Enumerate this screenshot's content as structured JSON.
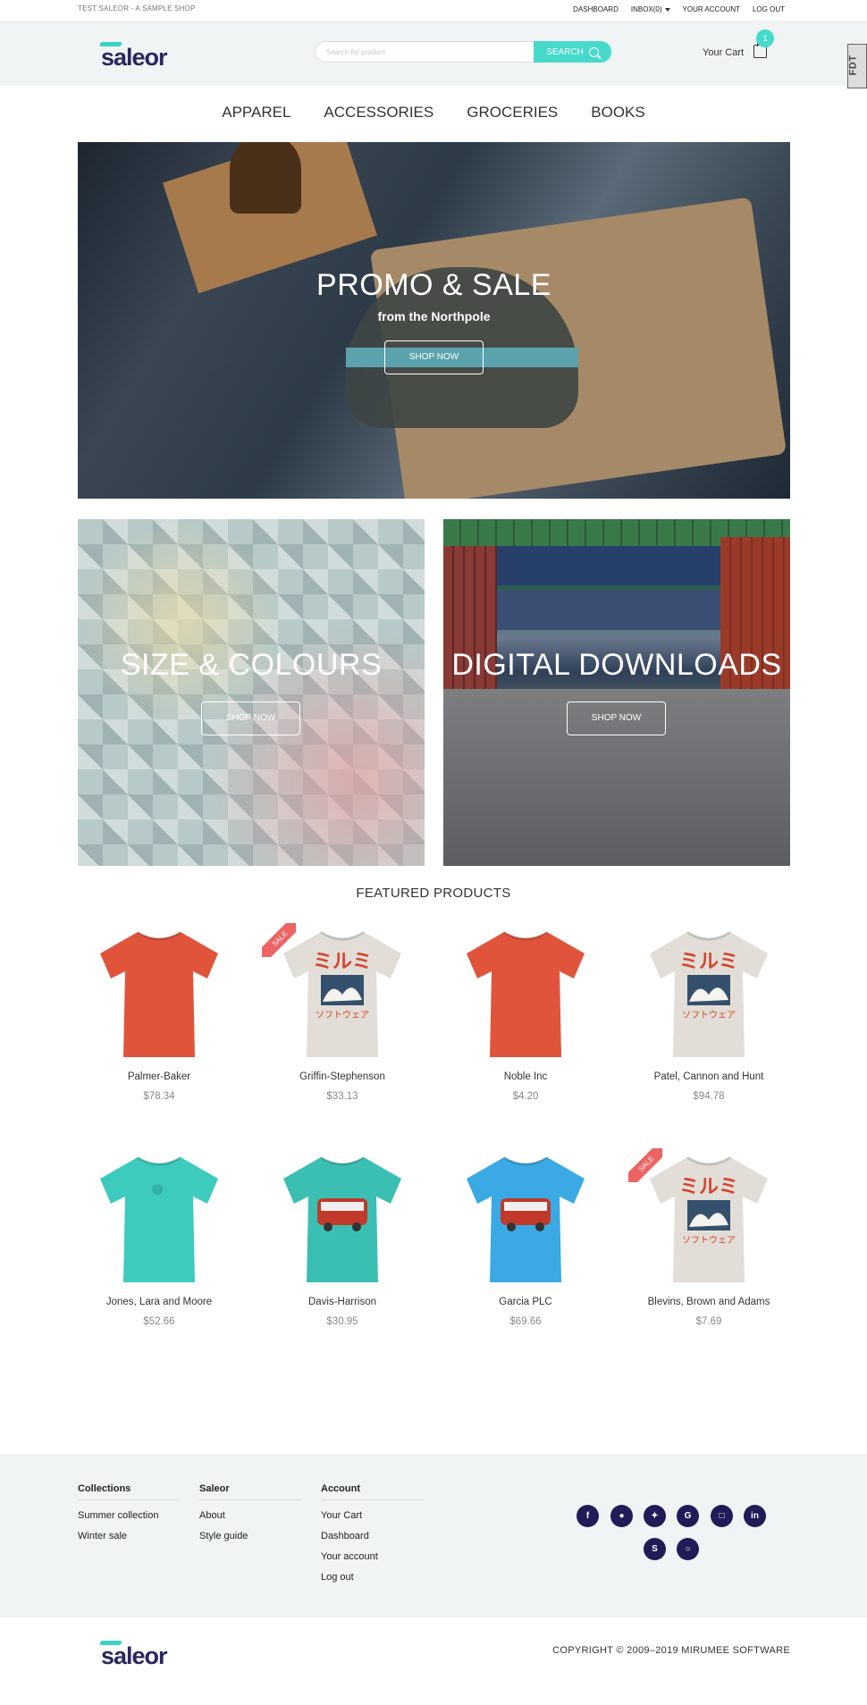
{
  "topbar": {
    "shop_name": "TEST SALEOR - A SAMPLE SHOP",
    "links": {
      "dashboard": "DASHBOARD",
      "inbox": "INBOX(0)",
      "account": "YOUR ACCOUNT",
      "logout": "LOG OUT"
    }
  },
  "header": {
    "logo": "saleor",
    "search_placeholder": "Search for product",
    "search_button": "SEARCH",
    "cart_label": "Your Cart",
    "cart_count": "1",
    "debug_badge": "FDT"
  },
  "nav": [
    "APPAREL",
    "ACCESSORIES",
    "GROCERIES",
    "BOOKS"
  ],
  "hero": {
    "title": "PROMO & SALE",
    "subtitle": "from the Northpole",
    "button": "SHOP NOW"
  },
  "tiles": [
    {
      "title": "SIZE & COLOURS",
      "button": "SHOP NOW"
    },
    {
      "title": "DIGITAL DOWNLOADS",
      "button": "SHOP NOW"
    }
  ],
  "featured": {
    "title": "FEATURED PRODUCTS",
    "sale_label": "SALE",
    "products": [
      {
        "name": "Palmer-Baker",
        "price": "$78.34",
        "shirt": "red",
        "sale": false
      },
      {
        "name": "Griffin-Stephenson",
        "price": "$33.13",
        "shirt": "white-print",
        "sale": true
      },
      {
        "name": "Noble Inc",
        "price": "$4.20",
        "shirt": "red",
        "sale": false
      },
      {
        "name": "Patel, Cannon and Hunt",
        "price": "$94.78",
        "shirt": "white-print",
        "sale": false
      },
      {
        "name": "Jones, Lara and Moore",
        "price": "$52.66",
        "shirt": "teal",
        "sale": false
      },
      {
        "name": "Davis-Harrison",
        "price": "$30.95",
        "shirt": "teal-bus",
        "sale": false
      },
      {
        "name": "Garcia PLC",
        "price": "$69.66",
        "shirt": "blue-bus",
        "sale": false
      },
      {
        "name": "Blevins, Brown and Adams",
        "price": "$7.69",
        "shirt": "white-print",
        "sale": true
      }
    ]
  },
  "footer": {
    "columns": [
      {
        "heading": "Collections",
        "items": [
          "Summer collection",
          "Winter sale"
        ]
      },
      {
        "heading": "Saleor",
        "items": [
          "About",
          "Style guide"
        ]
      },
      {
        "heading": "Account",
        "items": [
          "Your Cart",
          "Dashboard",
          "Your account",
          "Log out"
        ]
      }
    ],
    "social": [
      "facebook-icon",
      "github-icon",
      "twitter-icon",
      "google-plus-icon",
      "instagram-icon",
      "linkedin-icon",
      "skype-icon",
      "instagram-round-icon"
    ],
    "copyright": "COPYRIGHT © 2009–2019 MIRUMEE SOFTWARE"
  },
  "colors": {
    "accent": "#47dacb",
    "brand_dark": "#2a2660",
    "sale": "#ec6464",
    "footer_bg": "#f1f4f4"
  }
}
